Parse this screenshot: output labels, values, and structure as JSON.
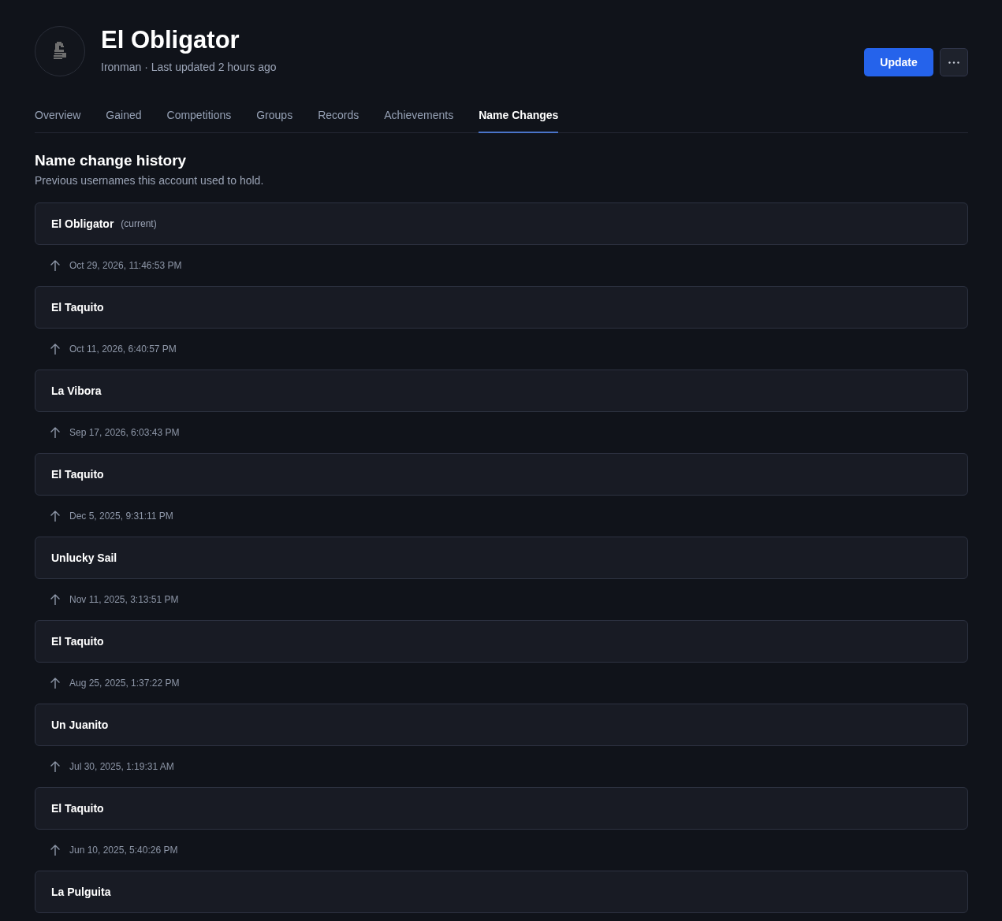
{
  "profile": {
    "name": "El Obligator",
    "subtitle": "Ironman · Last updated 2 hours ago",
    "update_button": "Update"
  },
  "tabs": [
    {
      "label": "Overview",
      "selected": false
    },
    {
      "label": "Gained",
      "selected": false
    },
    {
      "label": "Competitions",
      "selected": false
    },
    {
      "label": "Groups",
      "selected": false
    },
    {
      "label": "Records",
      "selected": false
    },
    {
      "label": "Achievements",
      "selected": false
    },
    {
      "label": "Name Changes",
      "selected": true
    }
  ],
  "section": {
    "title": "Name change history",
    "description": "Previous usernames this account used to hold."
  },
  "timeline": [
    {
      "kind": "name",
      "name": "El Obligator",
      "tag": "(current)"
    },
    {
      "kind": "change",
      "date": "Oct 29, 2026, 11:46:53 PM"
    },
    {
      "kind": "name",
      "name": "El Taquito"
    },
    {
      "kind": "change",
      "date": "Oct 11, 2026, 6:40:57 PM"
    },
    {
      "kind": "name",
      "name": "La Vibora"
    },
    {
      "kind": "change",
      "date": "Sep 17, 2026, 6:03:43 PM"
    },
    {
      "kind": "name",
      "name": "El Taquito"
    },
    {
      "kind": "change",
      "date": "Dec 5, 2025, 9:31:11 PM"
    },
    {
      "kind": "name",
      "name": "Unlucky Sail"
    },
    {
      "kind": "change",
      "date": "Nov 11, 2025, 3:13:51 PM"
    },
    {
      "kind": "name",
      "name": "El Taquito"
    },
    {
      "kind": "change",
      "date": "Aug 25, 2025, 1:37:22 PM"
    },
    {
      "kind": "name",
      "name": "Un Juanito"
    },
    {
      "kind": "change",
      "date": "Jul 30, 2025, 1:19:31 AM"
    },
    {
      "kind": "name",
      "name": "El Taquito"
    },
    {
      "kind": "change",
      "date": "Jun 10, 2025, 5:40:26 PM"
    },
    {
      "kind": "name",
      "name": "La Pulguita"
    }
  ]
}
